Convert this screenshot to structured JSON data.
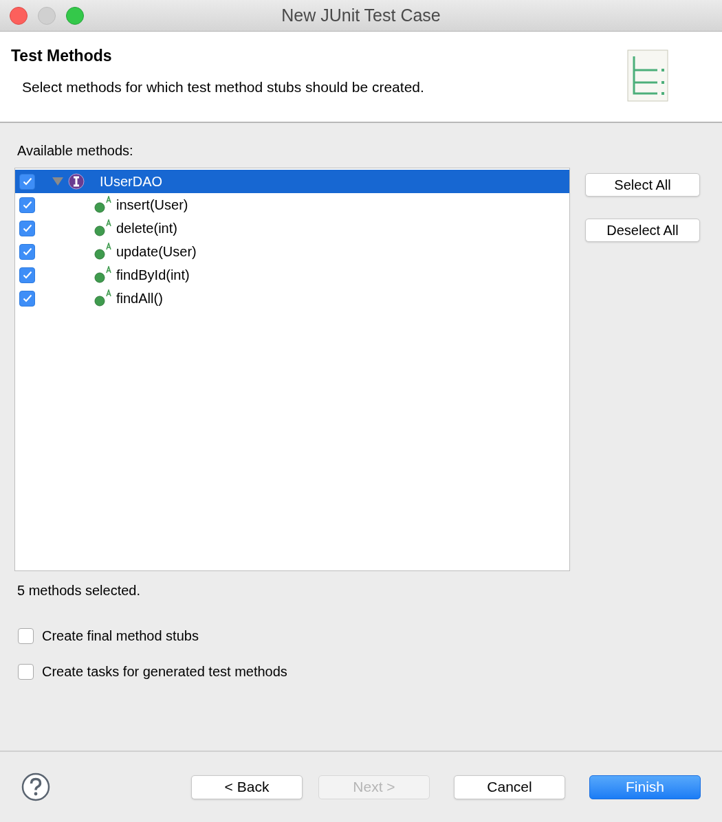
{
  "window": {
    "title": "New JUnit Test Case"
  },
  "header": {
    "title": "Test Methods",
    "description": "Select methods for which test method stubs should be created."
  },
  "methods_label": "Available methods:",
  "tree": [
    {
      "label": "IUserDAO",
      "kind": "interface",
      "checked": true,
      "selected": true,
      "expanded": true,
      "children": [
        {
          "label": "insert(User)",
          "kind": "method",
          "checked": true,
          "selected": false
        },
        {
          "label": "delete(int)",
          "kind": "method",
          "checked": true,
          "selected": false
        },
        {
          "label": "update(User)",
          "kind": "method",
          "checked": true,
          "selected": false
        },
        {
          "label": "findById(int)",
          "kind": "method",
          "checked": true,
          "selected": false
        },
        {
          "label": "findAll()",
          "kind": "method",
          "checked": true,
          "selected": false
        }
      ]
    }
  ],
  "side_buttons": [
    "Select All",
    "Deselect All"
  ],
  "status": "5 methods selected.",
  "options": [
    {
      "label": "Create final method stubs",
      "checked": false
    },
    {
      "label": "Create tasks for generated test methods",
      "checked": false
    }
  ],
  "buttons": [
    {
      "label": "< Back",
      "kind": "normal",
      "disabled": false
    },
    {
      "label": "Next >",
      "kind": "normal",
      "disabled": true
    },
    {
      "label": "Cancel",
      "kind": "normal",
      "disabled": false
    },
    {
      "label": "Finish",
      "kind": "default",
      "disabled": false
    }
  ]
}
